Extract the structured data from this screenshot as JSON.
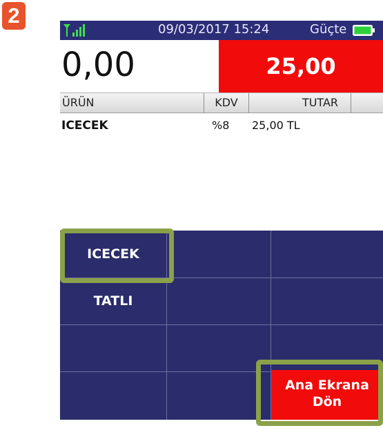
{
  "step_badge": "2",
  "status_bar": {
    "datetime": "09/03/2017 15:24",
    "power_label": "Güçte",
    "signal_icon": "signal-strength-icon",
    "battery_icon": "battery-icon",
    "battery_color": "#2fd13a"
  },
  "totals": {
    "left_amount": "0,00",
    "right_amount": "25,00",
    "right_bg_color": "#f10b0b"
  },
  "grid_header": {
    "columns": [
      "ÜRÜN",
      "KDV",
      "TUTAR"
    ]
  },
  "items": [
    {
      "name": "ICECEK",
      "kdv": "%8",
      "tutar": "25,00 TL"
    }
  ],
  "categories": [
    {
      "label": "ICECEK",
      "selected": true
    },
    {
      "label": "TATLI",
      "selected": false
    }
  ],
  "home_button": {
    "line1": "Ana Ekrana",
    "line2": "Dön"
  },
  "colors": {
    "panel_bg": "#2a2c6b",
    "highlight": "#8aa149",
    "accent_red": "#f10b0b"
  }
}
